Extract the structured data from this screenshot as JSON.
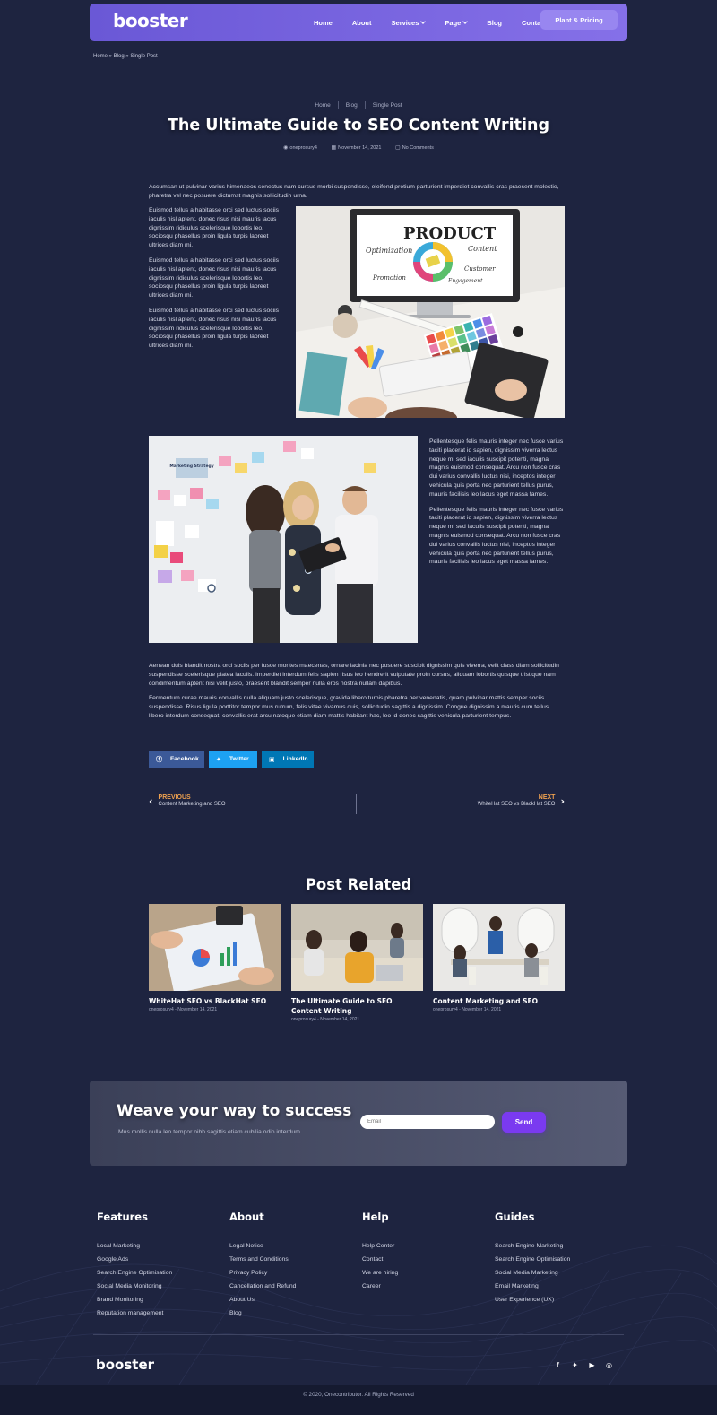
{
  "header": {
    "logo": "booster",
    "nav": [
      {
        "label": "Home",
        "dropdown": false
      },
      {
        "label": "About",
        "dropdown": false
      },
      {
        "label": "Services",
        "dropdown": true
      },
      {
        "label": "Page",
        "dropdown": true
      },
      {
        "label": "Blog",
        "dropdown": false
      },
      {
        "label": "Contact",
        "dropdown": false
      }
    ],
    "cta": "Plant & Pricing"
  },
  "top_breadcrumb": "Home » Blog » Single Post",
  "post": {
    "breadcrumb": [
      "Home",
      "Blog",
      "Single Post"
    ],
    "title": "The Ultimate Guide to SEO Content Writing",
    "meta": {
      "author": "oneprosury4",
      "date": "November 14, 2021",
      "comments": "No Comments"
    },
    "intro": "Accumsan ut pulvinar varius himenaeos senectus nam cursus morbi suspendisse, eleifend pretium parturient imperdiet convallis cras praesent molestie, pharetra vel nec posuere dictumst magnis sollicitudin urna.",
    "left_paragraphs": [
      "Euismod tellus a habitasse orci sed luctus sociis iaculis nisl aptent, donec risus nisi mauris lacus dignissim ridiculus scelerisque lobortis leo, sociosqu phasellus proin ligula turpis laoreet ultrices diam mi.",
      "Euismod tellus a habitasse orci sed luctus sociis iaculis nisl aptent, donec risus nisi mauris lacus dignissim ridiculus scelerisque lobortis leo, sociosqu phasellus proin ligula turpis laoreet ultrices diam mi.",
      "Euismod tellus a habitasse orci sed luctus sociis iaculis nisl aptent, donec risus nisi mauris lacus dignissim ridiculus scelerisque lobortis leo, sociosqu phasellus proin ligula turpis laoreet ultrices diam mi."
    ],
    "image1_words": {
      "product": "PRODUCT",
      "optimization": "Optimization",
      "content": "Content",
      "customer": "Customer",
      "promotion": "Promotion",
      "engagement": "Engagement"
    },
    "image2_words": {
      "board": "Marketing Strategy"
    },
    "right_paragraphs": [
      "Pellentesque felis mauris integer nec fusce varius taciti placerat id sapien, dignissim viverra lectus neque mi sed iaculis suscipit potenti, magna magnis euismod consequat. Arcu non fusce cras dui varius convallis luctus nisi, inceptos integer vehicula quis porta nec parturient tellus purus, mauris facilisis leo lacus eget massa fames.",
      "Pellentesque felis mauris integer nec fusce varius taciti placerat id sapien, dignissim viverra lectus neque mi sed iaculis suscipit potenti, magna magnis euismod consequat. Arcu non fusce cras dui varius convallis luctus nisi, inceptos integer vehicula quis porta nec parturient tellus purus, mauris facilisis leo lacus eget massa fames."
    ],
    "closing_paragraphs": [
      "Aenean duis blandit nostra orci sociis per fusce montes maecenas, ornare lacinia nec posuere suscipit dignissim quis viverra, velit class diam sollicitudin suspendisse scelerisque platea iaculis. Imperdiet interdum felis sapien risus leo hendrerit vulputate proin cursus, aliquam lobortis quisque tristique nam condimentum aptent nisi velit justo, praesent blandit semper nulla eros nostra nullam dapibus.",
      "Fermentum curae mauris convallis nulla aliquam justo scelerisque, gravida libero turpis pharetra per venenatis, quam pulvinar mattis semper sociis suspendisse. Risus ligula porttitor tempor mus rutrum, felis vitae vivamus duis, sollicitudin sagittis a dignissim. Congue dignissim a mauris cum tellus libero interdum consequat, convallis erat arcu natoque etiam diam mattis habitant hac, leo id donec sagittis vehicula parturient tempus."
    ],
    "share": [
      {
        "label": "Facebook",
        "icon": "facebook-icon",
        "color": "#3b5998"
      },
      {
        "label": "Twitter",
        "icon": "twitter-icon",
        "color": "#1da1f2"
      },
      {
        "label": "LinkedIn",
        "icon": "linkedin-icon",
        "color": "#0077b5"
      }
    ],
    "prev": {
      "label": "PREVIOUS",
      "title": "Content Marketing and SEO"
    },
    "next": {
      "label": "NEXT",
      "title": "WhiteHat SEO vs BlackHat SEO"
    }
  },
  "related": {
    "title": "Post Related",
    "cards": [
      {
        "title": "WhiteHat SEO vs BlackHat SEO",
        "meta": "oneprosury4 - November 14, 2021"
      },
      {
        "title": "The Ultimate Guide to SEO Content Writing",
        "meta": "oneprosury4 - November 14, 2021"
      },
      {
        "title": "Content Marketing and SEO",
        "meta": "oneprosury4 - November 14, 2021"
      }
    ]
  },
  "newsletter": {
    "title": "Weave your way to success",
    "subtitle": "Mus mollis nulla leo tempor nibh sagittis etiam cubilia odio interdum.",
    "placeholder": "Email",
    "button": "Send"
  },
  "footer": {
    "columns": [
      {
        "title": "Features",
        "items": [
          "Local Marketing",
          "Google Ads",
          "Search Engine Optimisation",
          "Social Media Monitoring",
          "Brand Monitoring",
          "Reputation management"
        ]
      },
      {
        "title": "About",
        "items": [
          "Legal Notice",
          "Terms and Conditions",
          "Privacy Policy",
          "Cancellation and Refund",
          "About Us",
          "Blog"
        ]
      },
      {
        "title": "Help",
        "items": [
          "Help Center",
          "Contact",
          "We are hiring",
          "Career"
        ]
      },
      {
        "title": "Guides",
        "items": [
          "Search Engine Marketing",
          "Search Engine Optimisation",
          "Social Media Marketing",
          "Email Marketing",
          "User Experience (UX)"
        ]
      }
    ],
    "logo": "booster",
    "social": [
      "facebook-icon",
      "twitter-icon",
      "youtube-icon",
      "instagram-icon"
    ],
    "copyright": "© 2020, Onecontributor. All Rights Reserved"
  },
  "colors": {
    "brand": "#7b66e0",
    "page_bg": "#1e2440",
    "accent_orange": "#f0a24f",
    "send_button": "#7a3af0"
  }
}
